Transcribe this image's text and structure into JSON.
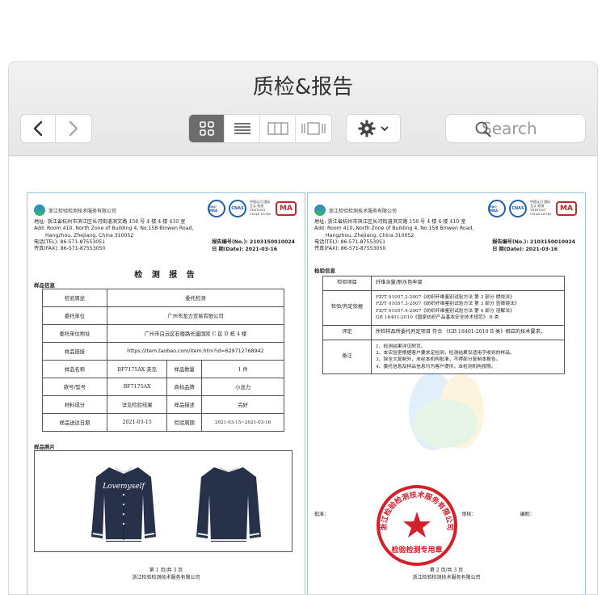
{
  "window": {
    "title": "质检&报告"
  },
  "toolbar": {
    "back_icon": "chevron-left-icon",
    "forward_icon": "chevron-right-icon",
    "view_modes": [
      "grid-view-icon",
      "list-view-icon",
      "column-view-icon",
      "gallery-view-icon"
    ],
    "active_view": "grid-view-icon",
    "action_icon": "gear-icon",
    "search_placeholder": "Search"
  },
  "colors": {
    "accent_active_view": "#6c6c6c",
    "stamp_red": "#d3202a",
    "doc_border": "#9cc3e0"
  },
  "report": {
    "org_name": "浙江检验检测技术服务有限公司",
    "cert_labels": [
      "ilac-MRA",
      "CNAS",
      "中国认可 国际互认 检测 TESTING CNAS L8740",
      "MA"
    ],
    "address_cn": "地址: 浙江省杭州市滨江区长河街道滨文路 158 号 4 楼 4 楼 410 室",
    "address_en_1": "Add: Room 410, North Zone of Building 4, No.158 Binwen Road,",
    "address_en_2": "Hangzhou, Zhejiang, China      310052",
    "tel": "电话(TEL):    86-571-87553051",
    "fax": "传真(FAX):    86-571-87553050",
    "report_no": "报告编号(No.): 2103150010024",
    "date": "日    期(Date): 2021-03-16"
  },
  "page1": {
    "heading": "检 测 报 告",
    "sample_info_label": "样品信息",
    "rows": [
      {
        "label": "检验周途",
        "value": "委托检测"
      },
      {
        "label": "委托单位",
        "value": "广州市龙力贸易有限公司"
      },
      {
        "label": "委托单位地址",
        "value": "广州市白云区石楼路长盛国际 C 区 D 栋 4 楼"
      },
      {
        "label": "样品链接",
        "value": "https://item.taobao.com/item.htm?id=629712768942"
      }
    ],
    "grid_rows": [
      {
        "l1": "样品名称",
        "v1": "BF7175AX 夹克",
        "l2": "样品数量",
        "v2": "1 件"
      },
      {
        "l1": "款号/型号",
        "v1": "BF7175AX",
        "l2": "商标品牌",
        "v2": "小龙力"
      },
      {
        "l1": "材料成分",
        "v1": "详见检验结果",
        "l2": "样品描述",
        "v2": "完好"
      },
      {
        "l1": "样品送达日期",
        "v1": "2021-03-15",
        "l2": "检验周期",
        "v2": "2021-03-15~2021-03-16"
      }
    ],
    "photo_label": "样品照片",
    "jacket_text": "Lovemyself",
    "page_num": "第 1 页/共 3 页",
    "footer_org": "浙江检验检测技术服务有限公司"
  },
  "page2": {
    "info_label": "检验信息",
    "rows": [
      {
        "label": "检验项目",
        "value": "纤维含量/耐水色牢度"
      },
      {
        "label": "检验/判定依据",
        "value": "FZ/T 01057.2-2007《纺织纤维鉴别试验方法 第 2 部分 燃烧法》\nFZ/T 01057.3-2007《纺织纤维鉴别试验方法 第 3 部分 显微镜法》\nFZ/T 01057.4-2007《纺织纤维鉴别试验方法 第 4 部分 溶解法》\nGB 18401-2010《国家纺织产品基本安全技术规范》 B 类"
      },
      {
        "label": "评定",
        "value": "所检样品所委托判定项目 符合 《GB 18401-2010 B 类》相应的技术要求。"
      },
      {
        "label": "备注",
        "value": "1、检测结果详见附页。\n2、本实验室根据客户要求定检测，检测结果仅适用于收到的样品。\n3、除全文复制外，未经本机构批准，不得部分复制本报告。\n4、委托信息及样品信息均为客户提供，本检测机构按照。"
      }
    ],
    "sig_approve": "批准：",
    "sig_review": "审核：",
    "sig_prepare": "编制：",
    "stamp_text": "浙江检验检测技术服务有限公司",
    "stamp_bottom": "检验检测专用章",
    "page_num": "第 2 页/共 3 页",
    "footer_org": "浙江检验检测技术服务有限公司"
  }
}
